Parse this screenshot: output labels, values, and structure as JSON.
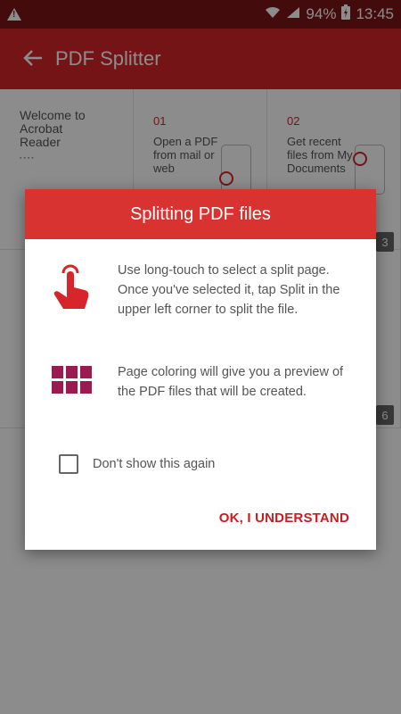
{
  "status_bar": {
    "battery": "94%",
    "time": "13:45",
    "icons": [
      "warning-icon",
      "wifi-icon",
      "signal-icon",
      "battery-icon"
    ]
  },
  "app_bar": {
    "title": "PDF Splitter",
    "back_icon": "arrow-left-icon"
  },
  "background": {
    "welcome_title": "Welcome to Acrobat Reader",
    "card1": {
      "num": "01",
      "text": "Open a PDF from mail or web"
    },
    "card2": {
      "num": "02",
      "text": "Get recent files from My Documents"
    },
    "badge_top": "3",
    "badge_bottom": "6"
  },
  "dialog": {
    "title": "Splitting PDF files",
    "tip1": "Use long-touch to select a split page. Once you've selected it, tap Split in the upper left corner to split the file.",
    "tip2": "Page coloring will give you a preview of the PDF files that will be created.",
    "checkbox_label": "Don't show this again",
    "ok_label": "OK, I UNDERSTAND"
  },
  "colors": {
    "app_bar": "#d6262b",
    "status_bar": "#7a1417",
    "accent": "#c81e22",
    "page_color": "#9a1b52"
  }
}
